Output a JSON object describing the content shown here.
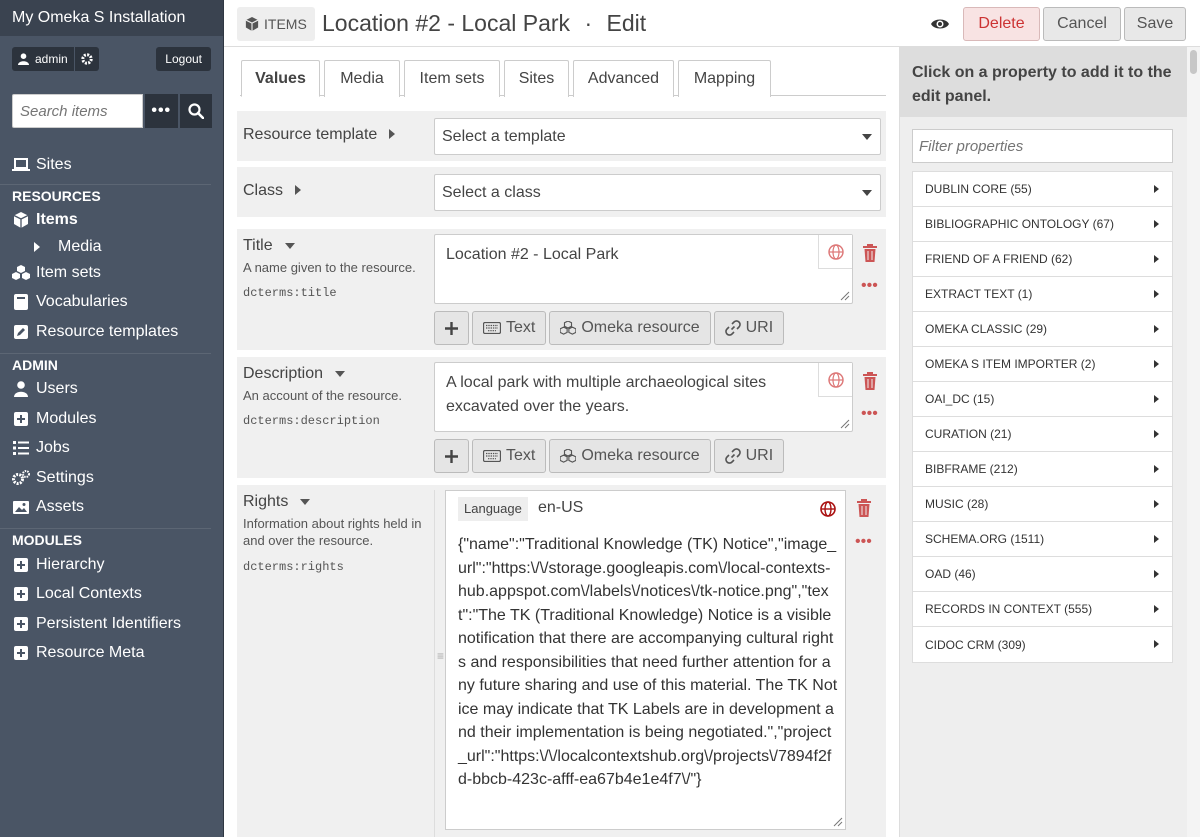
{
  "sidebar": {
    "site_title": "My Omeka S Installation",
    "user": "admin",
    "logout": "Logout",
    "search_placeholder": "Search items",
    "sites": "Sites",
    "resources_heading": "RESOURCES",
    "items": "Items",
    "media": "Media",
    "item_sets": "Item sets",
    "vocabularies": "Vocabularies",
    "resource_templates": "Resource templates",
    "admin_heading": "ADMIN",
    "users": "Users",
    "modules": "Modules",
    "jobs": "Jobs",
    "settings": "Settings",
    "assets": "Assets",
    "modules_heading": "MODULES",
    "hierarchy": "Hierarchy",
    "local_contexts": "Local Contexts",
    "persistent_identifiers": "Persistent Identifiers",
    "resource_meta": "Resource Meta"
  },
  "header": {
    "section_tag": "ITEMS",
    "title": "Location #2 - Local Park",
    "separator": "·",
    "mode": "Edit",
    "delete": "Delete",
    "cancel": "Cancel",
    "save": "Save"
  },
  "tabs": [
    "Values",
    "Media",
    "Item sets",
    "Sites",
    "Advanced",
    "Mapping"
  ],
  "form": {
    "resource_template_label": "Resource template",
    "resource_template_value": "Select a template",
    "class_label": "Class",
    "class_value": "Select a class",
    "title": {
      "label": "Title",
      "desc": "A name given to the resource.",
      "term": "dcterms:title",
      "value": "Location #2 - Local Park"
    },
    "description": {
      "label": "Description",
      "desc": "An account of the resource.",
      "term": "dcterms:description",
      "value": "A local park with multiple archaeological sites excavated over the years."
    },
    "rights": {
      "label": "Rights",
      "desc": "Information about rights held in and over the resource.",
      "term": "dcterms:rights",
      "language_label": "Language",
      "language_value": "en-US",
      "value": "{\"name\":\"Traditional Knowledge (TK) Notice\",\"image_url\":\"https:\\/\\/storage.googleapis.com\\/local-contexts-hub.appspot.com\\/labels\\/notices\\/tk-notice.png\",\"text\":\"The TK (Traditional Knowledge) Notice is a visible notification that there are accompanying cultural rights and responsibilities that need further attention for any future sharing and use of this material. The TK Notice may indicate that TK Labels are in development and their implementation is being negotiated.\",\"project_url\":\"https:\\/\\/localcontextshub.org\\/projects\\/7894f2fd-bbcb-423c-afff-ea67b4e1e4f7\\/\"}"
    },
    "add_buttons": {
      "text": "Text",
      "omeka_resource": "Omeka resource",
      "uri": "URI"
    }
  },
  "panel": {
    "heading": "Click on a property to add it to the edit panel.",
    "filter_placeholder": "Filter properties",
    "vocabularies": [
      "DUBLIN CORE (55)",
      "BIBLIOGRAPHIC ONTOLOGY (67)",
      "FRIEND OF A FRIEND (62)",
      "EXTRACT TEXT (1)",
      "OMEKA CLASSIC (29)",
      "OMEKA S ITEM IMPORTER (2)",
      "OAI_DC (15)",
      "CURATION (21)",
      "BIBFRAME (212)",
      "MUSIC (28)",
      "SCHEMA.ORG (1511)",
      "OAD (46)",
      "RECORDS IN CONTEXT (555)",
      "CIDOC CRM (309)"
    ]
  },
  "colors": {
    "sidebar_bg": "#4a5565",
    "delete_text": "#cc3333",
    "accent_red": "#cc5555"
  }
}
